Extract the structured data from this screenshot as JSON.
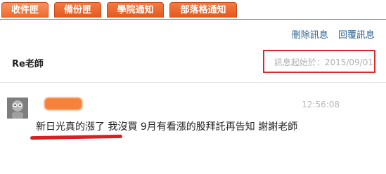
{
  "tabs": [
    {
      "label": "收件匣",
      "active": true
    },
    {
      "label": "備份匣",
      "active": false
    },
    {
      "label": "學院通知",
      "active": false
    },
    {
      "label": "部落格通知",
      "active": false
    }
  ],
  "actions": {
    "delete_label": "刪除訊息",
    "reply_label": "回覆訊息"
  },
  "message": {
    "subject": "Re老師",
    "since_label": "訊息起始於：2015/09/01",
    "time": "12:56:08",
    "body": "新日光真的漲了 我沒買 9月有看漲的股拜託再告知 謝謝老師"
  },
  "colors": {
    "tab_orange": "#ef6a2d",
    "link_blue": "#2a5f8f",
    "highlight_red": "#e0272a"
  },
  "icons": {
    "avatar": "user-avatar-icon"
  }
}
